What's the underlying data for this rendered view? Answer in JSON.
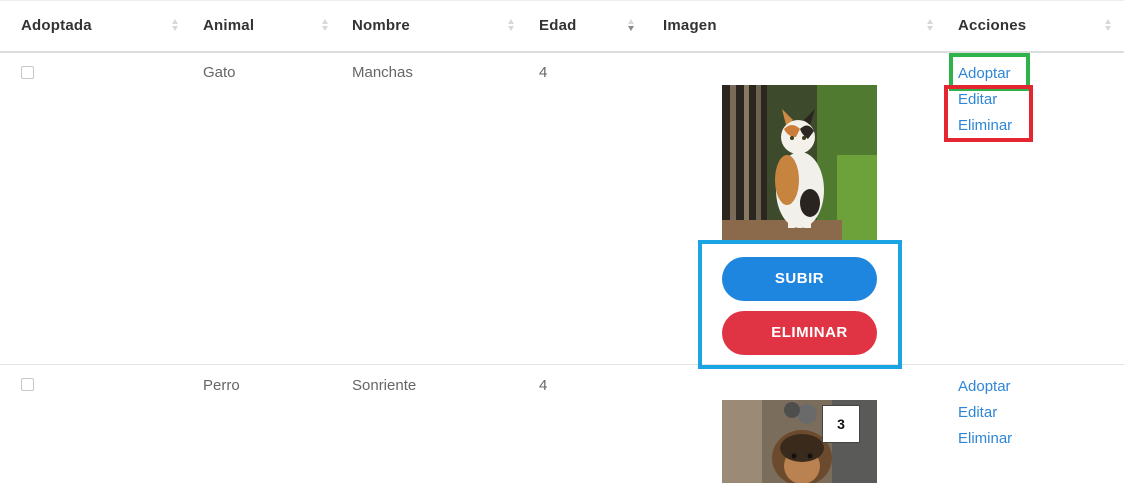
{
  "table": {
    "headers": [
      {
        "label": "Adoptada",
        "sort_state": "none"
      },
      {
        "label": "Animal",
        "sort_state": "none"
      },
      {
        "label": "Nombre",
        "sort_state": "none"
      },
      {
        "label": "Edad",
        "sort_state": "descending"
      },
      {
        "label": "Imagen",
        "sort_state": "none"
      },
      {
        "label": "Acciones",
        "sort_state": "none"
      }
    ],
    "rows": [
      {
        "adopted": false,
        "animal": "Gato",
        "name": "Manchas",
        "age": "4",
        "image_subject": "calico cat",
        "actions": {
          "adopt": "Adoptar",
          "edit": "Editar",
          "delete": "Eliminar"
        },
        "image_buttons": {
          "upload": "SUBIR",
          "delete": "ELIMINAR"
        }
      },
      {
        "adopted": false,
        "animal": "Perro",
        "name": "Sonriente",
        "age": "4",
        "image_subject": "brown dog",
        "actions": {
          "adopt": "Adoptar",
          "edit": "Editar",
          "delete": "Eliminar"
        },
        "badge": "3"
      }
    ]
  },
  "colors": {
    "link": "#2f86d6",
    "upload_button": "#1f86df",
    "delete_button": "#e03444",
    "highlight_green": "#2db34a",
    "highlight_red": "#e3262f",
    "highlight_blue": "#1ba4e3"
  }
}
